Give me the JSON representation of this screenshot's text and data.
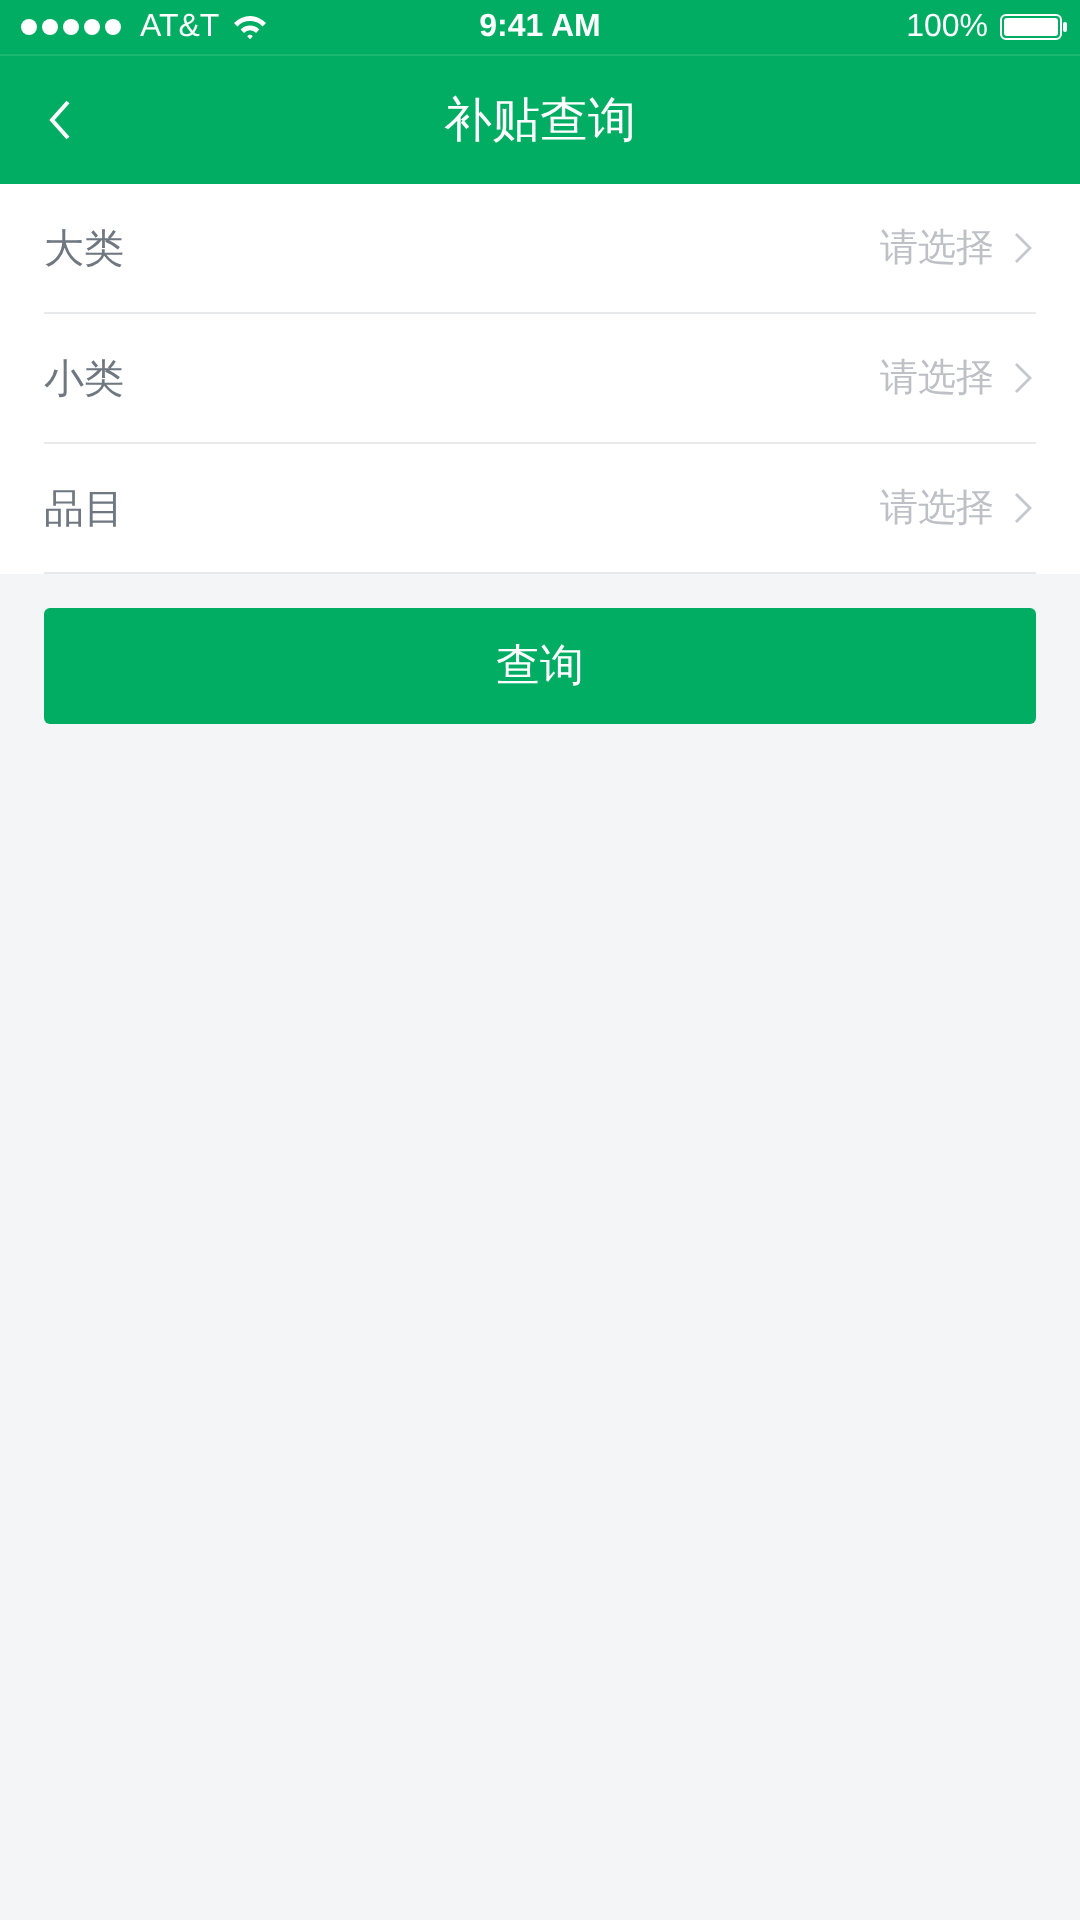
{
  "status_bar": {
    "carrier": "AT&T",
    "time": "9:41 AM",
    "battery": "100%"
  },
  "nav_bar": {
    "title": "补贴查询"
  },
  "fields": [
    {
      "label": "大类",
      "placeholder": "请选择"
    },
    {
      "label": "小类",
      "placeholder": "请选择"
    },
    {
      "label": "品目",
      "placeholder": "请选择"
    }
  ],
  "buttons": [
    "查询"
  ]
}
